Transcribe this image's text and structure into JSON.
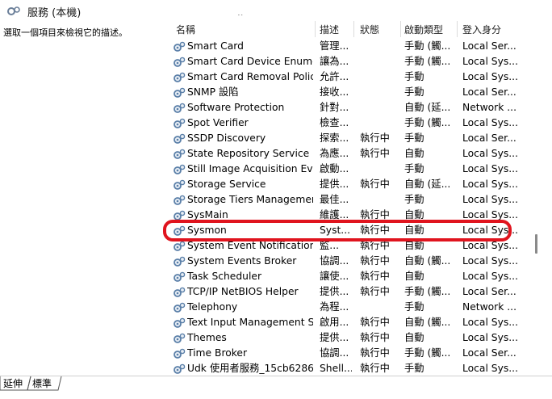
{
  "window": {
    "title": "服務 (本機)"
  },
  "left_pane": {
    "description": "選取一個項目來檢視它的描述。"
  },
  "columns": {
    "name": "名稱",
    "description": "描述",
    "status": "狀態",
    "startup": "啟動類型",
    "logon": "登入身分"
  },
  "rows": [
    {
      "name": "Smart Card",
      "desc": "管理...",
      "status": "",
      "startup": "手動 (觸...",
      "logon": "Local Ser..."
    },
    {
      "name": "Smart Card Device Enume...",
      "desc": "讓為...",
      "status": "",
      "startup": "手動 (觸...",
      "logon": "Local Sys..."
    },
    {
      "name": "Smart Card Removal Policy",
      "desc": "允許...",
      "status": "",
      "startup": "手動",
      "logon": "Local Sys..."
    },
    {
      "name": "SNMP 設陷",
      "desc": "接收...",
      "status": "",
      "startup": "手動",
      "logon": "Local Ser..."
    },
    {
      "name": "Software Protection",
      "desc": "針對...",
      "status": "",
      "startup": "自動 (延...",
      "logon": "Network ..."
    },
    {
      "name": "Spot Verifier",
      "desc": "檢查...",
      "status": "",
      "startup": "手動 (觸...",
      "logon": "Local Sys..."
    },
    {
      "name": "SSDP Discovery",
      "desc": "探索...",
      "status": "執行中",
      "startup": "手動",
      "logon": "Local Ser..."
    },
    {
      "name": "State Repository Service",
      "desc": "為應...",
      "status": "執行中",
      "startup": "自動",
      "logon": "Local Sys..."
    },
    {
      "name": "Still Image Acquisition Eve...",
      "desc": "啟動...",
      "status": "",
      "startup": "手動",
      "logon": "Local Sys..."
    },
    {
      "name": "Storage Service",
      "desc": "提供...",
      "status": "執行中",
      "startup": "自動 (延...",
      "logon": "Local Sys..."
    },
    {
      "name": "Storage Tiers Management",
      "desc": "最佳...",
      "status": "",
      "startup": "手動",
      "logon": "Local Sys..."
    },
    {
      "name": "SysMain",
      "desc": "維護...",
      "status": "執行中",
      "startup": "自動",
      "logon": "Local Sys..."
    },
    {
      "name": "Sysmon",
      "desc": "Syst...",
      "status": "執行中",
      "startup": "自動",
      "logon": "Local Sys..."
    },
    {
      "name": "System Event Notification ...",
      "desc": "監...",
      "status": "執行中",
      "startup": "自動",
      "logon": "Local Sys..."
    },
    {
      "name": "System Events Broker",
      "desc": "協調...",
      "status": "執行中",
      "startup": "自動 (觸...",
      "logon": "Local Sys..."
    },
    {
      "name": "Task Scheduler",
      "desc": "讓使...",
      "status": "執行中",
      "startup": "自動",
      "logon": "Local Sys..."
    },
    {
      "name": "TCP/IP NetBIOS Helper",
      "desc": "提供...",
      "status": "執行中",
      "startup": "手動 (觸...",
      "logon": "Local Ser..."
    },
    {
      "name": "Telephony",
      "desc": "為程...",
      "status": "",
      "startup": "手動",
      "logon": "Network ..."
    },
    {
      "name": "Text Input Management S...",
      "desc": "啟用...",
      "status": "執行中",
      "startup": "自動 (觸...",
      "logon": "Local Sys..."
    },
    {
      "name": "Themes",
      "desc": "提供...",
      "status": "執行中",
      "startup": "自動",
      "logon": "Local Sys..."
    },
    {
      "name": "Time Broker",
      "desc": "協調...",
      "status": "執行中",
      "startup": "手動 (觸...",
      "logon": "Local Ser..."
    },
    {
      "name": "Udk 使用者服務_15cb6286",
      "desc": "Shell...",
      "status": "執行中",
      "startup": "手動",
      "logon": "Local Sys..."
    }
  ],
  "tabs": {
    "extended": "延伸",
    "standard": "標準"
  },
  "colors": {
    "highlight": "#e0141e",
    "gear": "#5a7fa8"
  }
}
